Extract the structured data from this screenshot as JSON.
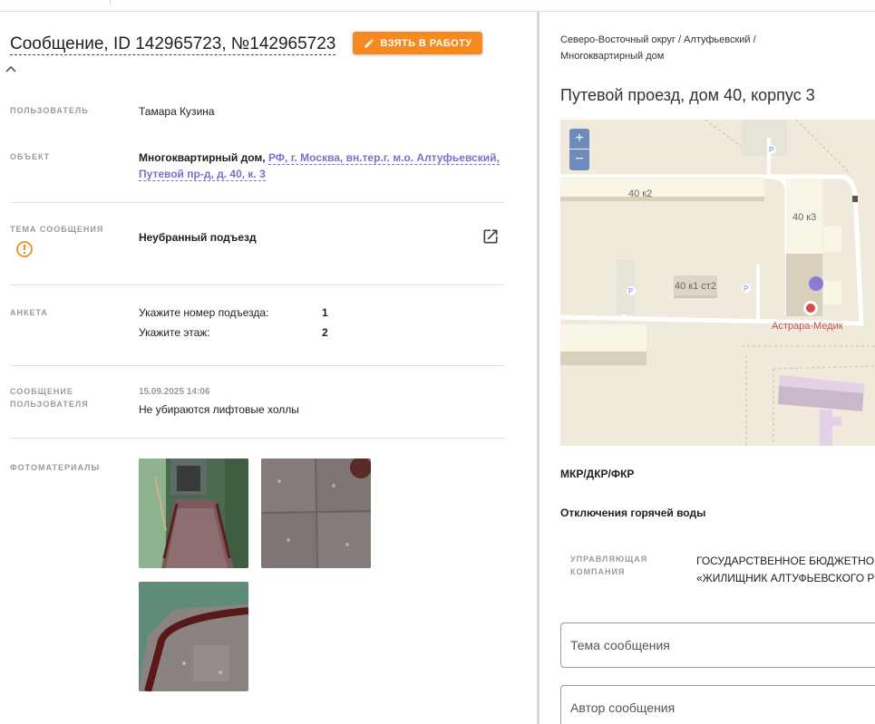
{
  "message": {
    "title": "Сообщение, ID 142965723, №142965723",
    "take_button": "ВЗЯТЬ В РАБОТУ"
  },
  "fields": {
    "user": {
      "label": "ПОЛЬЗОВАТЕЛЬ",
      "value": "Тамара Кузина"
    },
    "object": {
      "label": "ОБЪЕКТ",
      "type": "Многоквартирный дом,",
      "address_line1": "РФ, г. Москва, вн.тер.г. м.о. Алтуфьевский,",
      "address_line2": "Путевой пр-д, д. 40, к. 3"
    },
    "topic": {
      "label": "ТЕМА СООБЩЕНИЯ",
      "value": "Неубранный подъезд"
    },
    "survey": {
      "label": "АНКЕТА",
      "rows": [
        {
          "question": "Укажите номер подъезда:",
          "answer": "1"
        },
        {
          "question": "Укажите этаж:",
          "answer": "2"
        }
      ]
    },
    "user_message": {
      "label_line1": "СООБЩЕНИЕ",
      "label_line2": "ПОЛЬЗОВАТЕЛЯ",
      "date": "15.09.2025 14:06",
      "text": "Не убираются лифтовые холлы"
    },
    "photos": {
      "label": "ФОТОМАТЕРИАЛЫ",
      "count": 3
    }
  },
  "right": {
    "breadcrumb_line1": "Северо-Восточный округ / Алтуфьевский /",
    "breadcrumb_line2": "Многоквартирный дом",
    "address": "Путевой проезд, дом 40, корпус 3",
    "map": {
      "zoom_in": "+",
      "zoom_out": "−",
      "building_a": "40 к2",
      "building_b": "40 к3",
      "building_c": "40 к1 ст2",
      "poi": "Астрара-Медик"
    },
    "section1": "МКР/ДКР/ФКР",
    "section2": "Отключения горячей воды",
    "mgmt_label_line1": "УПРАВЛЯЮЩАЯ",
    "mgmt_label_line2": "КОМПАНИЯ",
    "mgmt_value_line1": "ГОСУДАРСТВЕННОЕ БЮДЖЕТНОЕ",
    "mgmt_value_line2": "«ЖИЛИЩНИК АЛТУФЬЕВСКОГО Р",
    "field_topic_placeholder": "Тема сообщения",
    "field_author_placeholder": "Автор сообщения"
  },
  "colors": {
    "accent": "#f6891f",
    "link": "#7e6fc9",
    "warning": "#f6891f"
  }
}
